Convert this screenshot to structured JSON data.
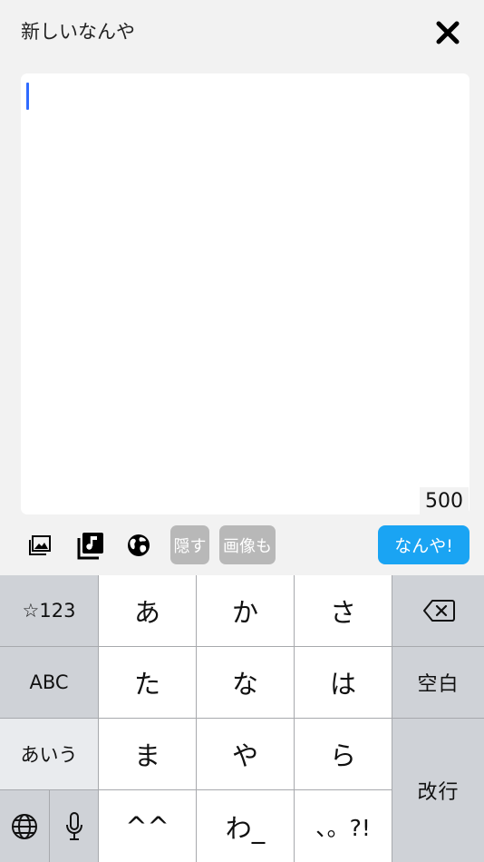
{
  "header": {
    "title": "新しいなんや",
    "close_icon": "close-icon"
  },
  "editor": {
    "text": "",
    "remaining_count": "500"
  },
  "toolbar": {
    "icons": [
      "image-icon",
      "music-library-icon",
      "globe-icon"
    ],
    "hide_label": "隠す",
    "image_label": "画像も",
    "submit_label": "なんや!",
    "submit_color": "#1aa4f3"
  },
  "keyboard": {
    "left_column": [
      "☆123",
      "ABC",
      "あいう"
    ],
    "left_bottom_icons": [
      "globe-icon",
      "microphone-icon"
    ],
    "kana_rows": [
      [
        "あ",
        "か",
        "さ"
      ],
      [
        "た",
        "な",
        "は"
      ],
      [
        "ま",
        "や",
        "ら"
      ],
      [
        "^^",
        "わ_",
        "、。?!"
      ]
    ],
    "right_column": {
      "backspace_icon": "backspace-icon",
      "space_label": "空白",
      "return_label": "改行"
    }
  }
}
